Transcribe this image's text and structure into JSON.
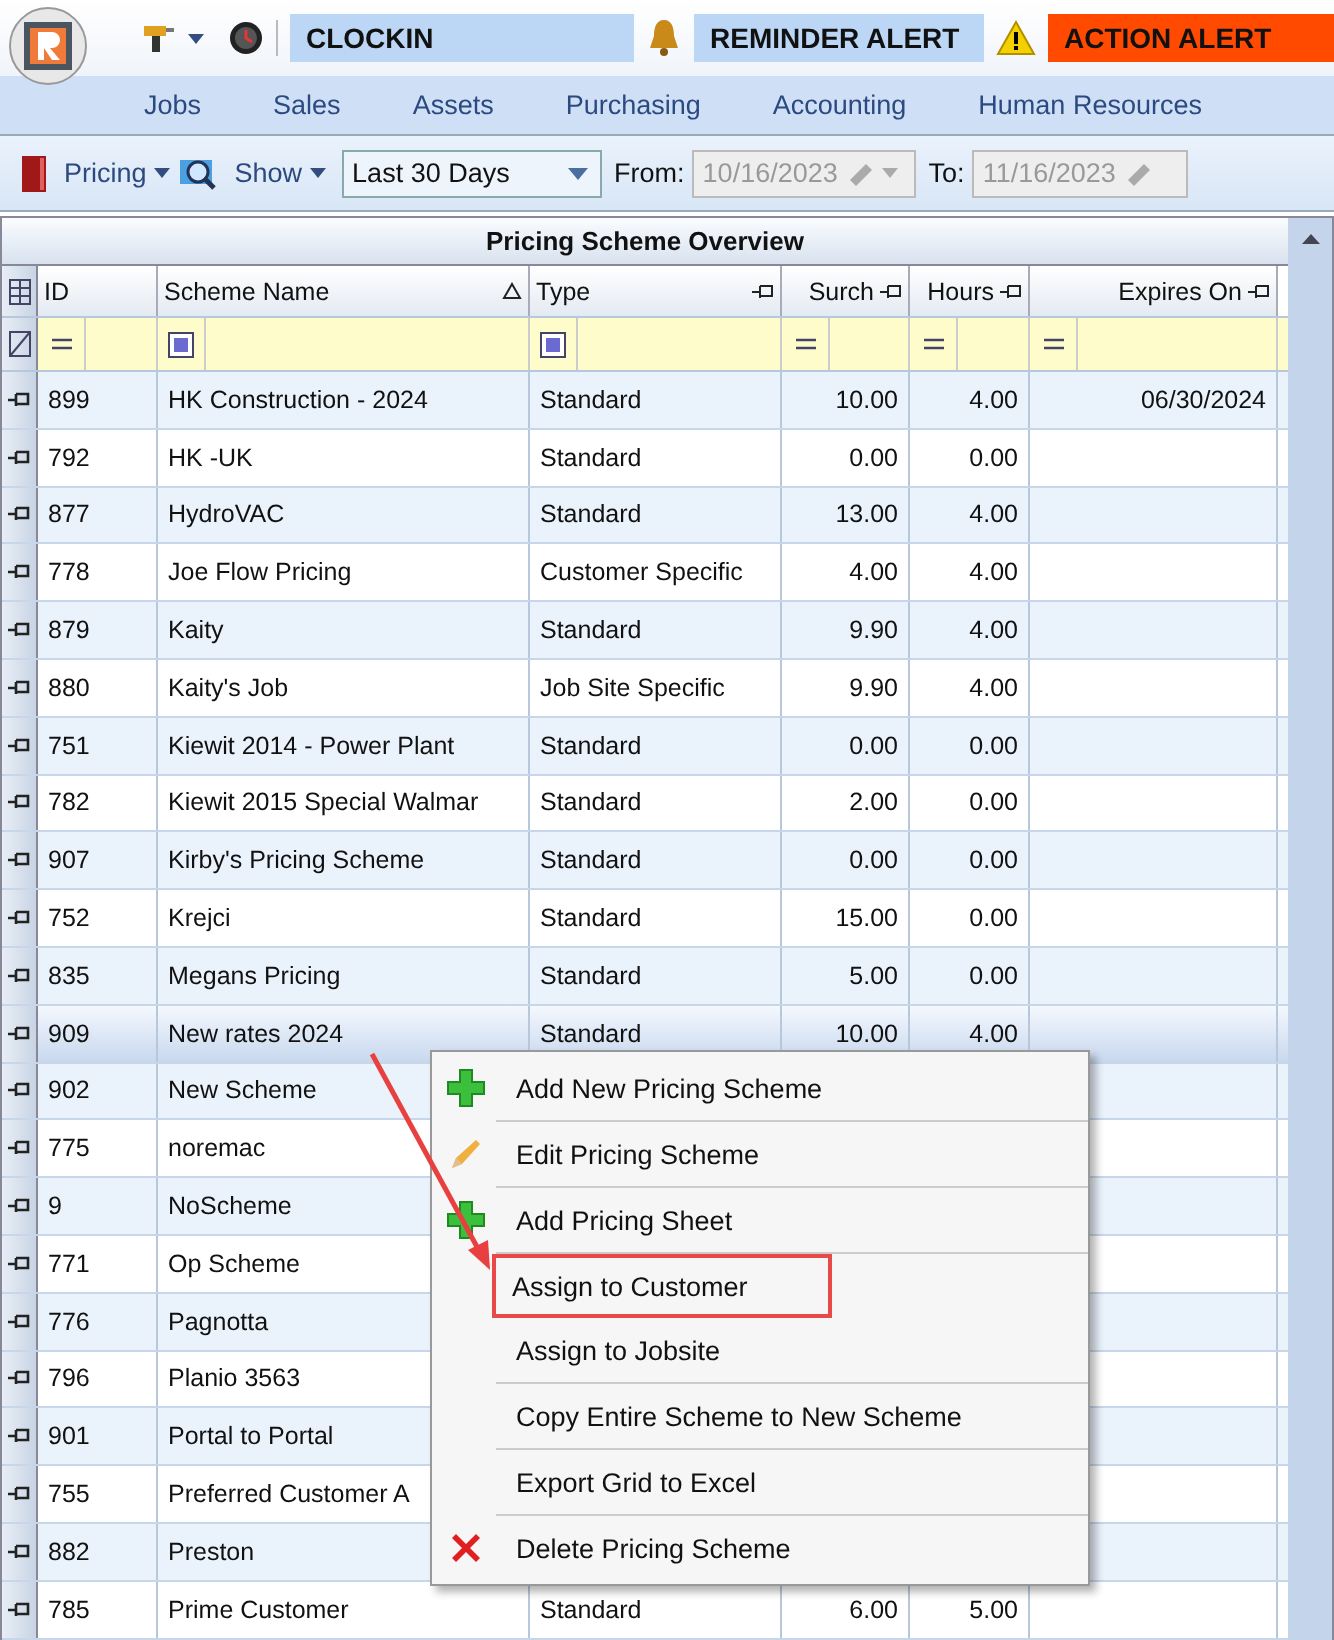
{
  "top_bar": {
    "clock_label": "CLOCKIN",
    "reminder_label": "REMINDER ALERT",
    "action_label": "ACTION ALERT"
  },
  "nav_tabs": [
    "Jobs",
    "Sales",
    "Assets",
    "Purchasing",
    "Accounting",
    "Human Resources"
  ],
  "filter_bar": {
    "pricing_label": "Pricing",
    "show_label": "Show",
    "range": "Last 30 Days",
    "from_label": "From:",
    "from_value": "10/16/2023",
    "to_label": "To:",
    "to_value": "11/16/2023"
  },
  "grid": {
    "title": "Pricing Scheme Overview",
    "columns": [
      "ID",
      "Scheme Name",
      "Type",
      "Surch",
      "Hours",
      "Expires On"
    ],
    "rows": [
      {
        "cells": [
          "899",
          "HK Construction - 2024",
          "Standard",
          "10.00",
          "4.00",
          "06/30/2024"
        ],
        "selected": false
      },
      {
        "cells": [
          "792",
          "HK -UK",
          "Standard",
          "0.00",
          "0.00"
        ],
        "selected": false
      },
      {
        "cells": [
          "877",
          "HydroVAC",
          "Standard",
          "13.00",
          "4.00"
        ],
        "selected": false
      },
      {
        "cells": [
          "778",
          "Joe Flow Pricing",
          "Customer Specific",
          "4.00",
          "4.00"
        ],
        "selected": false
      },
      {
        "cells": [
          "879",
          "Kaity",
          "Standard",
          "9.90",
          "4.00"
        ],
        "selected": false
      },
      {
        "cells": [
          "880",
          "Kaity's Job",
          "Job Site Specific",
          "9.90",
          "4.00"
        ],
        "selected": false
      },
      {
        "cells": [
          "751",
          "Kiewit 2014 - Power Plant",
          "Standard",
          "0.00",
          "0.00"
        ],
        "selected": false
      },
      {
        "cells": [
          "782",
          "Kiewit 2015 Special Walmar",
          "Standard",
          "2.00",
          "0.00"
        ],
        "selected": false
      },
      {
        "cells": [
          "907",
          "Kirby's Pricing Scheme",
          "Standard",
          "0.00",
          "0.00"
        ],
        "selected": false
      },
      {
        "cells": [
          "752",
          "Krejci",
          "Standard",
          "15.00",
          "0.00"
        ],
        "selected": false
      },
      {
        "cells": [
          "835",
          "Megans Pricing",
          "Standard",
          "5.00",
          "0.00"
        ],
        "selected": false
      },
      {
        "cells": [
          "909",
          "New rates 2024",
          "Standard",
          "10.00",
          "4.00"
        ],
        "selected": true
      },
      {
        "cells": [
          "902",
          "New Scheme"
        ],
        "selected": false
      },
      {
        "cells": [
          "775",
          "noremac"
        ],
        "selected": false
      },
      {
        "cells": [
          "9",
          "NoScheme"
        ],
        "selected": false
      },
      {
        "cells": [
          "771",
          "Op Scheme"
        ],
        "selected": false
      },
      {
        "cells": [
          "776",
          "Pagnotta"
        ],
        "selected": false
      },
      {
        "cells": [
          "796",
          "Planio 3563"
        ],
        "selected": false
      },
      {
        "cells": [
          "901",
          "Portal to Portal"
        ],
        "selected": false
      },
      {
        "cells": [
          "755",
          "Preferred Customer A"
        ],
        "selected": false
      },
      {
        "cells": [
          "882",
          "Preston"
        ],
        "selected": false
      },
      {
        "cells": [
          "785",
          "Prime Customer",
          "Standard",
          "6.00",
          "5.00"
        ],
        "selected": false
      }
    ]
  },
  "context_menu": {
    "items": [
      {
        "label": "Add New Pricing Scheme",
        "highlighted": false
      },
      {
        "label": "Edit Pricing Scheme",
        "highlighted": false
      },
      {
        "label": "Add Pricing Sheet",
        "highlighted": false
      },
      {
        "label": "Assign to Customer",
        "highlighted": true
      },
      {
        "label": "Assign to Jobsite",
        "highlighted": false
      },
      {
        "label": "Copy Entire Scheme to New Scheme",
        "highlighted": false
      },
      {
        "label": "Export Grid to Excel",
        "highlighted": false
      },
      {
        "label": "Delete Pricing Scheme",
        "highlighted": false
      }
    ]
  }
}
